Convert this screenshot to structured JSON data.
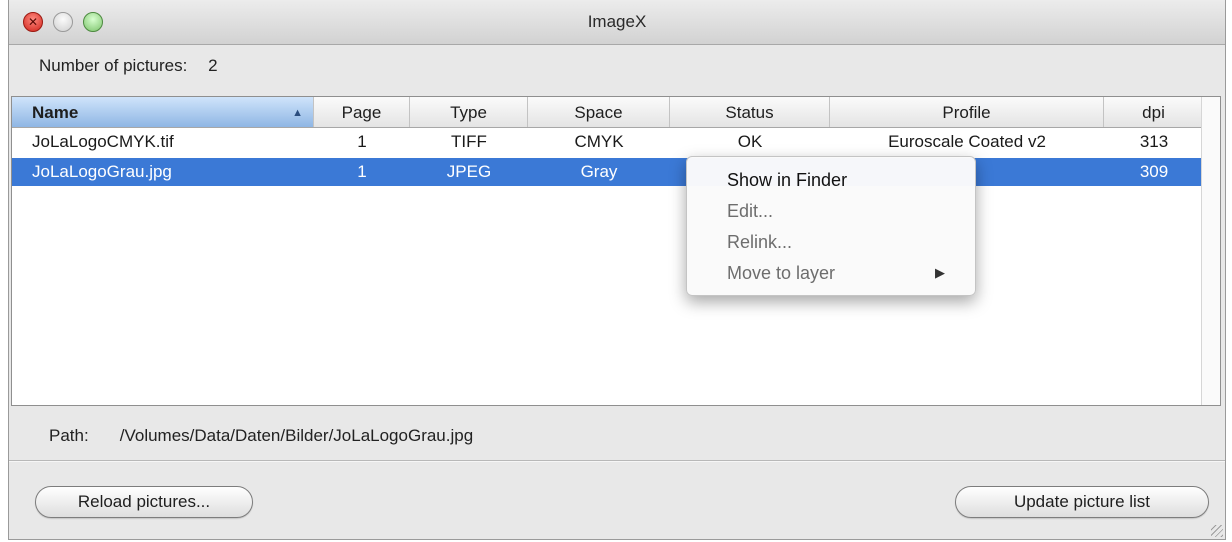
{
  "window": {
    "title": "ImageX"
  },
  "summary": {
    "label": "Number of pictures:",
    "value": "2"
  },
  "table": {
    "columns": [
      "Name",
      "Page",
      "Type",
      "Space",
      "Status",
      "Profile",
      "dpi"
    ],
    "sorted_column": "Name",
    "rows": [
      {
        "name": "JoLaLogoCMYK.tif",
        "page": "1",
        "type": "TIFF",
        "space": "CMYK",
        "status": "OK",
        "profile": "Euroscale Coated v2",
        "dpi": "313",
        "selected": false
      },
      {
        "name": "JoLaLogoGrau.jpg",
        "page": "1",
        "type": "JPEG",
        "space": "Gray",
        "status": "",
        "profile": "",
        "dpi": "309",
        "selected": true
      }
    ]
  },
  "path": {
    "label": "Path:",
    "value": "/Volumes/Data/Daten/Bilder/JoLaLogoGrau.jpg"
  },
  "buttons": {
    "reload": "Reload pictures...",
    "update": "Update picture list"
  },
  "context_menu": {
    "items": [
      {
        "label": "Show in Finder",
        "enabled": true,
        "submenu": false
      },
      {
        "label": "Edit...",
        "enabled": false,
        "submenu": false
      },
      {
        "label": "Relink...",
        "enabled": false,
        "submenu": false
      },
      {
        "label": "Move to layer",
        "enabled": false,
        "submenu": true
      }
    ]
  },
  "colors": {
    "selection": "#3b79d6",
    "header_sorted": "#8fb6e4"
  }
}
